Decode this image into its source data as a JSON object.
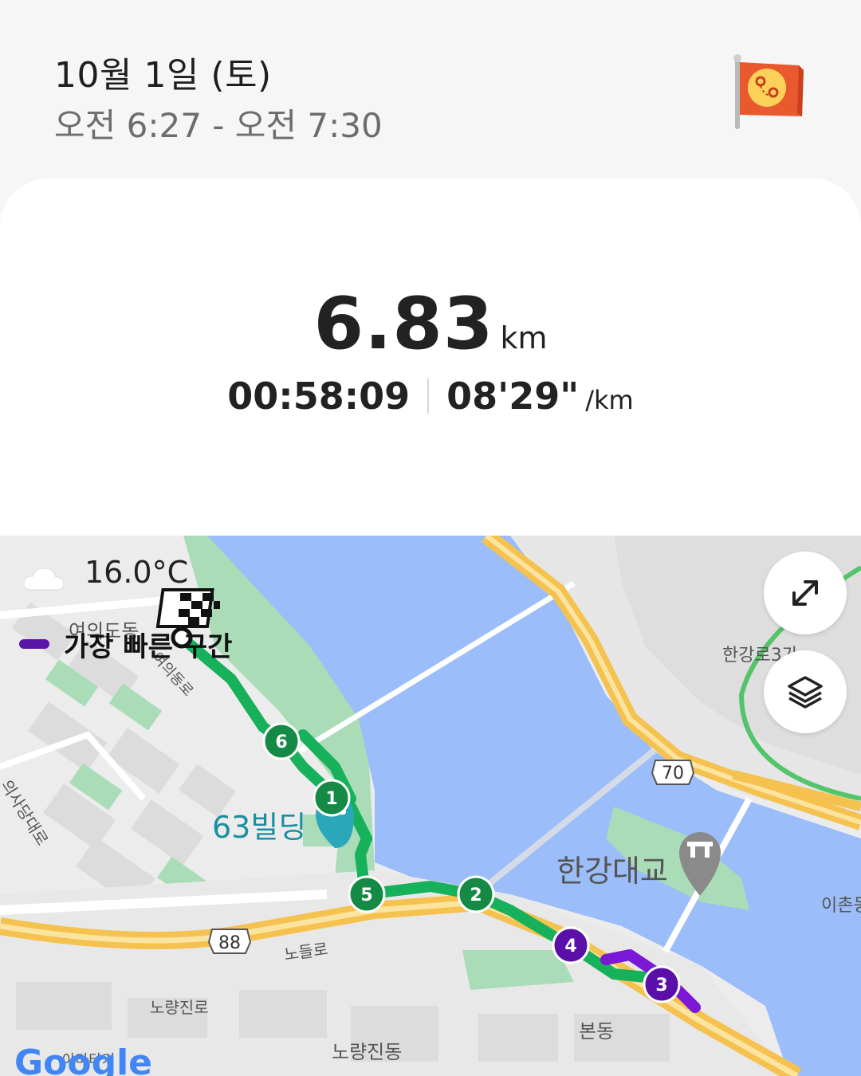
{
  "header": {
    "date": "10월 1일 (토)",
    "time_range": "오전 6:27 - 오전 7:30",
    "flag_icon": "map-flag-icon"
  },
  "summary": {
    "distance_value": "6.83",
    "distance_unit": "km",
    "duration": "00:58:09",
    "pace": "08'29\"",
    "pace_unit": "/km"
  },
  "map": {
    "temperature": "16.0°C",
    "weather_icon": "cloud-icon",
    "legend_label": "가장 빠른 구간",
    "legend_color": "#5b14a8",
    "route_color": "#16b15a",
    "fast_segment_color": "#7a18d6",
    "water_color": "#9bbdf9",
    "park_color": "#a9dcb7",
    "highway_color": "#f5c24f",
    "labels": {
      "yeouido_dong": "여의도동",
      "yeouidong_ro": "여의동로",
      "uisadang_daero": "의사당대로",
      "building_63": "63빌딩",
      "hangang_bridge": "한강대교",
      "hangangro": "한강로3가",
      "ichon": "이촌동",
      "route_70": "70",
      "route_88": "88",
      "nodeul_ro": "노들로",
      "noryangjin_ro": "노량진로",
      "noryangjin_dong": "노량진동",
      "bon_dong": "본동",
      "google": "Google",
      "amatage": "아마타기"
    },
    "markers": [
      "1",
      "2",
      "3",
      "4",
      "5",
      "6"
    ],
    "expand_icon": "expand-icon",
    "layers_icon": "layers-icon"
  }
}
